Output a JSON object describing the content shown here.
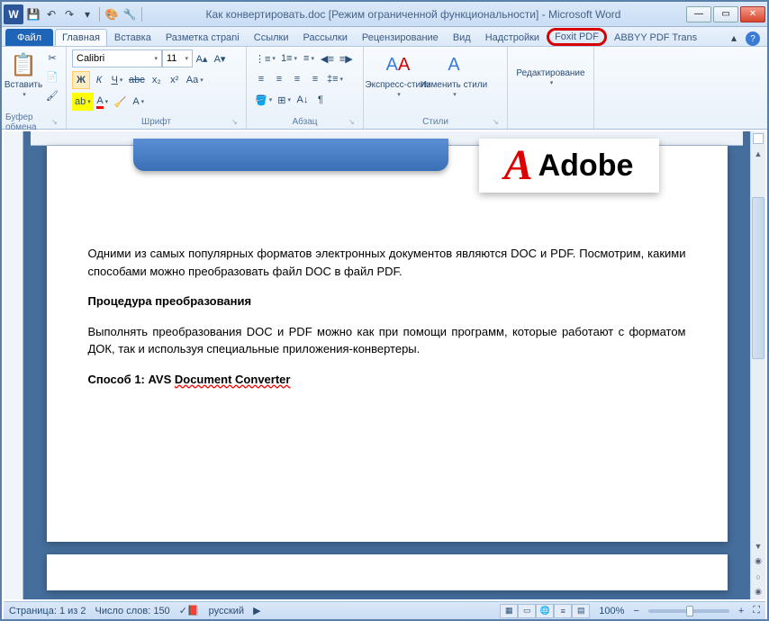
{
  "titlebar": {
    "doc_name": "Как конвертировать.doc",
    "mode": "[Режим ограниченной функциональности]",
    "app": "Microsoft Word"
  },
  "tabs": {
    "file": "Файл",
    "items": [
      "Главная",
      "Вставка",
      "Разметка страni",
      "Ссылки",
      "Рассылки",
      "Рецензирование",
      "Вид",
      "Надстройки",
      "Foxit PDF",
      "ABBYY PDF Trans"
    ],
    "active": 0,
    "highlight": 8
  },
  "ribbon": {
    "clipboard": {
      "paste": "Вставить",
      "label": "Буфер обмена"
    },
    "font": {
      "label": "Шрифт",
      "name": "Calibri",
      "size": "11",
      "bold": "Ж",
      "italic": "К",
      "underline": "Ч",
      "strike": "abc",
      "sub": "x₂",
      "sup": "x²"
    },
    "paragraph": {
      "label": "Абзац"
    },
    "styles": {
      "label": "Стили",
      "quick": "Экспресс-стили",
      "change": "Изменить стили"
    },
    "editing": {
      "label": "Редактирование"
    }
  },
  "document": {
    "adobe": "Adobe",
    "p1": "Одними из самых популярных форматов электронных документов являются DOC и PDF. Посмотрим, какими способами можно преобразовать файл DOC в файл PDF.",
    "h1": "Процедура преобразования",
    "p2": "Выполнять преобразования DOC и PDF можно как при помощи программ, которые работают с форматом ДОК, так и используя специальные приложения-конвертеры.",
    "h2_prefix": "Способ 1: AVS ",
    "h2_wavy": "Document Converter"
  },
  "statusbar": {
    "page": "Страница: 1 из 2",
    "words": "Число слов: 150",
    "lang": "русский",
    "zoom": "100%"
  }
}
